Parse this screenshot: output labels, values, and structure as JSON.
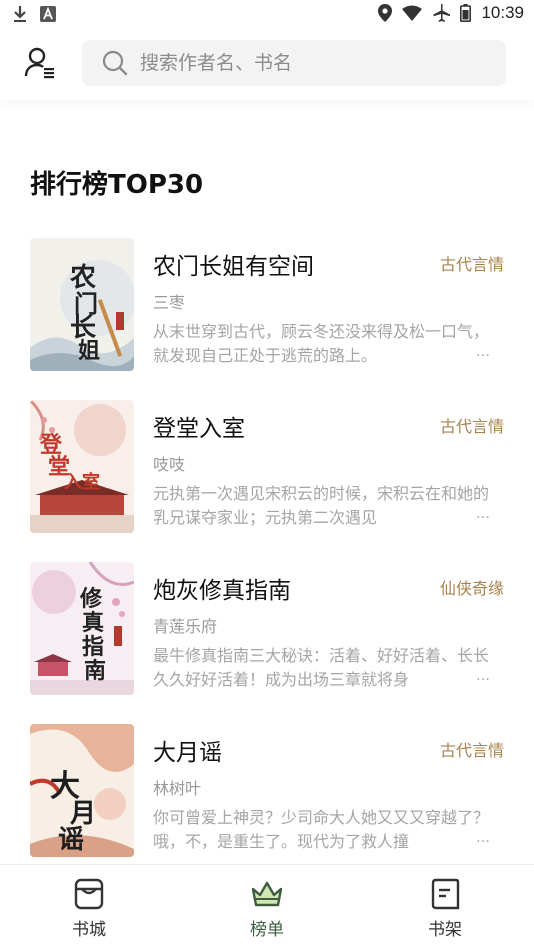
{
  "status_bar": {
    "time": "10:39"
  },
  "header": {
    "search_placeholder": "搜索作者名、书名"
  },
  "section_title": "排行榜TOP30",
  "books": [
    {
      "title": "农门长姐有空间",
      "author": "三枣",
      "tag": "古代言情",
      "desc": "从末世穿到古代，顾云冬还没来得及松一口气，就发现自己正处于逃荒的路上。",
      "cover_text": "农门长姐",
      "cover_colors": [
        "#f3f1ec",
        "#d8dee3",
        "#3a3a3a"
      ]
    },
    {
      "title": "登堂入室",
      "author": "吱吱",
      "tag": "古代言情",
      "desc": "元执第一次遇见宋积云的时候，宋积云在和她的乳兄谋夺家业；元执第二次遇见",
      "cover_text": "登堂入室",
      "cover_colors": [
        "#f7ede8",
        "#e9bfb4",
        "#c0392b"
      ]
    },
    {
      "title": "炮灰修真指南",
      "author": "青莲乐府",
      "tag": "仙侠奇缘",
      "desc": "最牛修真指南三大秘诀：活着、好好活着、长长久久好好活着！成为出场三章就将身",
      "cover_text": "修真指南",
      "cover_colors": [
        "#f6eef3",
        "#e8c7d6",
        "#2b2b2b"
      ]
    },
    {
      "title": "大月谣",
      "author": "林树叶",
      "tag": "古代言情",
      "desc": "你可曾爱上神灵？少司命大人她又又又穿越了？哦，不，是重生了。现代为了救人撞",
      "cover_text": "大月谣",
      "cover_colors": [
        "#f7eee6",
        "#e5a58a",
        "#1e1e1e"
      ]
    }
  ],
  "more_symbol": "…",
  "bottom_nav": [
    {
      "label": "书城",
      "icon": "store-icon",
      "active": false
    },
    {
      "label": "榜单",
      "icon": "crown-icon",
      "active": true
    },
    {
      "label": "书架",
      "icon": "bookshelf-icon",
      "active": false
    }
  ],
  "colors": {
    "accent": "#3c5d3e",
    "tag": "#a8834f",
    "muted": "#a5a5a5"
  }
}
